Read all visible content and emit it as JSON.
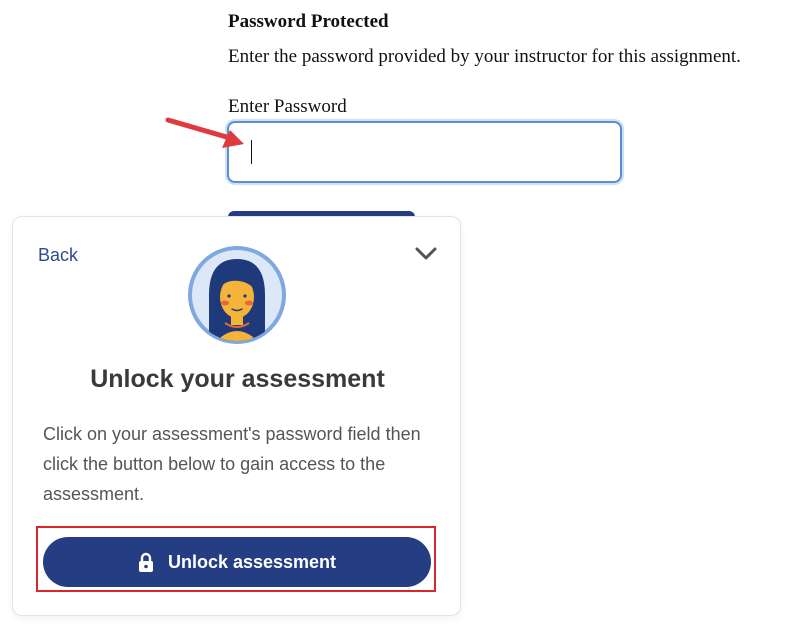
{
  "assignment": {
    "title": "Password Protected",
    "description": "Enter the password provided by your instructor for this assignment.",
    "field_label": "Enter Password",
    "field_value": ""
  },
  "helper": {
    "back_label": "Back",
    "collapse_icon": "chevron-down-icon",
    "avatar_icon": "assistant-avatar",
    "headline": "Unlock your assessment",
    "body": "Click on your assessment's password field then click the button below to gain access to the assessment.",
    "unlock_label": "Unlock assessment",
    "unlock_icon": "lock-icon"
  },
  "colors": {
    "brand": "#253d82",
    "focus_border": "#5a8fd0",
    "highlight": "#d8262b",
    "arrow": "#e0393e"
  }
}
